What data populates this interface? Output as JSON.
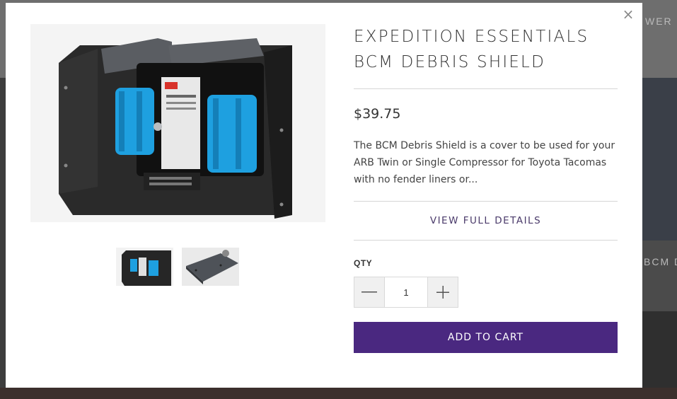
{
  "background": {
    "right_text_top": "WER C",
    "right_text_mid": "BCM D"
  },
  "modal": {
    "close_symbol": "×",
    "product": {
      "title": "EXPEDITION ESSENTIALS BCM DEBRIS SHIELD",
      "price": "$39.75",
      "description": "The BCM Debris Shield is a cover to be used for your ARB Twin or Single Compressor for Toyota Tacomas with no fender liners or...",
      "view_details_label": "VIEW FULL DETAILS",
      "qty_label": "QTY",
      "qty_value": "1",
      "add_to_cart_label": "ADD TO CART"
    },
    "thumbnails": [
      {
        "icon": "compressor-shield-thumbnail"
      },
      {
        "icon": "shield-bracket-thumbnail"
      }
    ],
    "colors": {
      "accent": "#4a2880",
      "link": "#4a3a6a",
      "compressor_blue": "#1ea0e0"
    }
  }
}
